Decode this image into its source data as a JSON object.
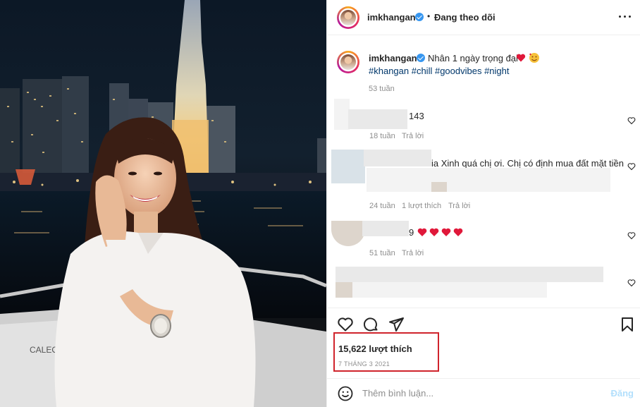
{
  "post": {
    "username": "imkhangan",
    "dot": "•",
    "follow_label": "Đang theo dõi"
  },
  "caption": {
    "username": "imkhangan",
    "text": "Nhân 1 ngày trọng đại",
    "hashtags": "#khangan #chill #goodvibes #night",
    "time": "53 tuần"
  },
  "comments": [
    {
      "text": "143",
      "time": "18 tuần",
      "likes": "",
      "reply": "Trả lời"
    },
    {
      "text": "ia Xinh quá chị ơi. Chị có định mua đất mặt tiền",
      "time": "24 tuần",
      "likes": "1 lượt thích",
      "reply": "Trả lời"
    },
    {
      "text": "9",
      "time": "51 tuần",
      "likes": "",
      "reply": "Trả lời"
    },
    {
      "text": "",
      "time": "",
      "likes": "",
      "reply": ""
    }
  ],
  "stats": {
    "likes": "15,622 lượt thích",
    "date": "7 THÁNG 3 2021"
  },
  "add_comment": {
    "placeholder": "Thêm bình luận...",
    "post_label": "Đăng"
  },
  "icons": {
    "more": "more-options-icon",
    "like": "heart-icon",
    "comment": "comment-icon",
    "share": "paper-plane-icon",
    "save": "bookmark-icon",
    "emoji": "emoji-icon"
  },
  "colors": {
    "verified": "#3897f0",
    "hashtag": "#00376b",
    "highlight_box": "#d0242c",
    "heart_emoji": "#e0183a",
    "post_disabled": "#b2dffc"
  }
}
